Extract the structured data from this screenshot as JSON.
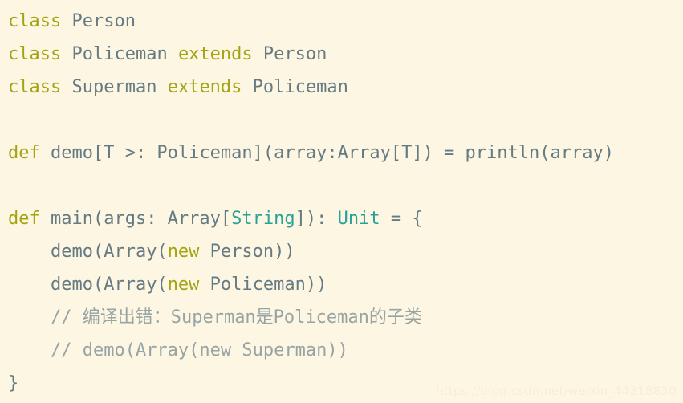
{
  "editor": {
    "language": "scala",
    "background_color": "#fdf6e3",
    "colors": {
      "keyword": "#a3a412",
      "identifier": "#657b83",
      "type": "#2aa198",
      "comment": "#97a4a4",
      "watermark": "#f6eeda"
    },
    "lines": [
      {
        "id": "line-1",
        "indent": 0,
        "tokens": [
          {
            "text": "class ",
            "kind": "keyword"
          },
          {
            "text": "Person",
            "kind": "plain"
          }
        ]
      },
      {
        "id": "line-2",
        "indent": 0,
        "tokens": [
          {
            "text": "class ",
            "kind": "keyword"
          },
          {
            "text": "Policeman ",
            "kind": "plain"
          },
          {
            "text": "extends ",
            "kind": "keyword"
          },
          {
            "text": "Person",
            "kind": "plain"
          }
        ]
      },
      {
        "id": "line-3",
        "indent": 0,
        "tokens": [
          {
            "text": "class ",
            "kind": "keyword"
          },
          {
            "text": "Superman ",
            "kind": "plain"
          },
          {
            "text": "extends ",
            "kind": "keyword"
          },
          {
            "text": "Policeman",
            "kind": "plain"
          }
        ]
      },
      {
        "id": "line-4",
        "indent": 0,
        "tokens": []
      },
      {
        "id": "line-5",
        "indent": 0,
        "tokens": [
          {
            "text": "def ",
            "kind": "keyword"
          },
          {
            "text": "demo[T >: Policeman](array:Array[T]) = println(array)",
            "kind": "plain"
          }
        ]
      },
      {
        "id": "line-6",
        "indent": 0,
        "tokens": []
      },
      {
        "id": "line-7",
        "indent": 0,
        "tokens": [
          {
            "text": "def ",
            "kind": "keyword"
          },
          {
            "text": "main(args: Array[",
            "kind": "plain"
          },
          {
            "text": "String",
            "kind": "type"
          },
          {
            "text": "]): ",
            "kind": "plain"
          },
          {
            "text": "Unit",
            "kind": "type"
          },
          {
            "text": " = {",
            "kind": "plain"
          }
        ]
      },
      {
        "id": "line-8",
        "indent": 4,
        "tokens": [
          {
            "text": "demo(Array(",
            "kind": "plain"
          },
          {
            "text": "new",
            "kind": "keyword"
          },
          {
            "text": " Person))",
            "kind": "plain"
          }
        ]
      },
      {
        "id": "line-9",
        "indent": 4,
        "tokens": [
          {
            "text": "demo(Array(",
            "kind": "plain"
          },
          {
            "text": "new",
            "kind": "keyword"
          },
          {
            "text": " Policeman))",
            "kind": "plain"
          }
        ]
      },
      {
        "id": "line-10",
        "indent": 4,
        "tokens": [
          {
            "text": "// 编译出错：Superman是Policeman的子类",
            "kind": "comment"
          }
        ]
      },
      {
        "id": "line-11",
        "indent": 4,
        "tokens": [
          {
            "text": "// demo(Array(new Superman))",
            "kind": "comment"
          }
        ]
      },
      {
        "id": "line-12",
        "indent": 0,
        "tokens": [
          {
            "text": "}",
            "kind": "plain"
          }
        ]
      }
    ]
  },
  "watermark": {
    "text": "https://blog.csdn.net/weixin_44318830"
  }
}
